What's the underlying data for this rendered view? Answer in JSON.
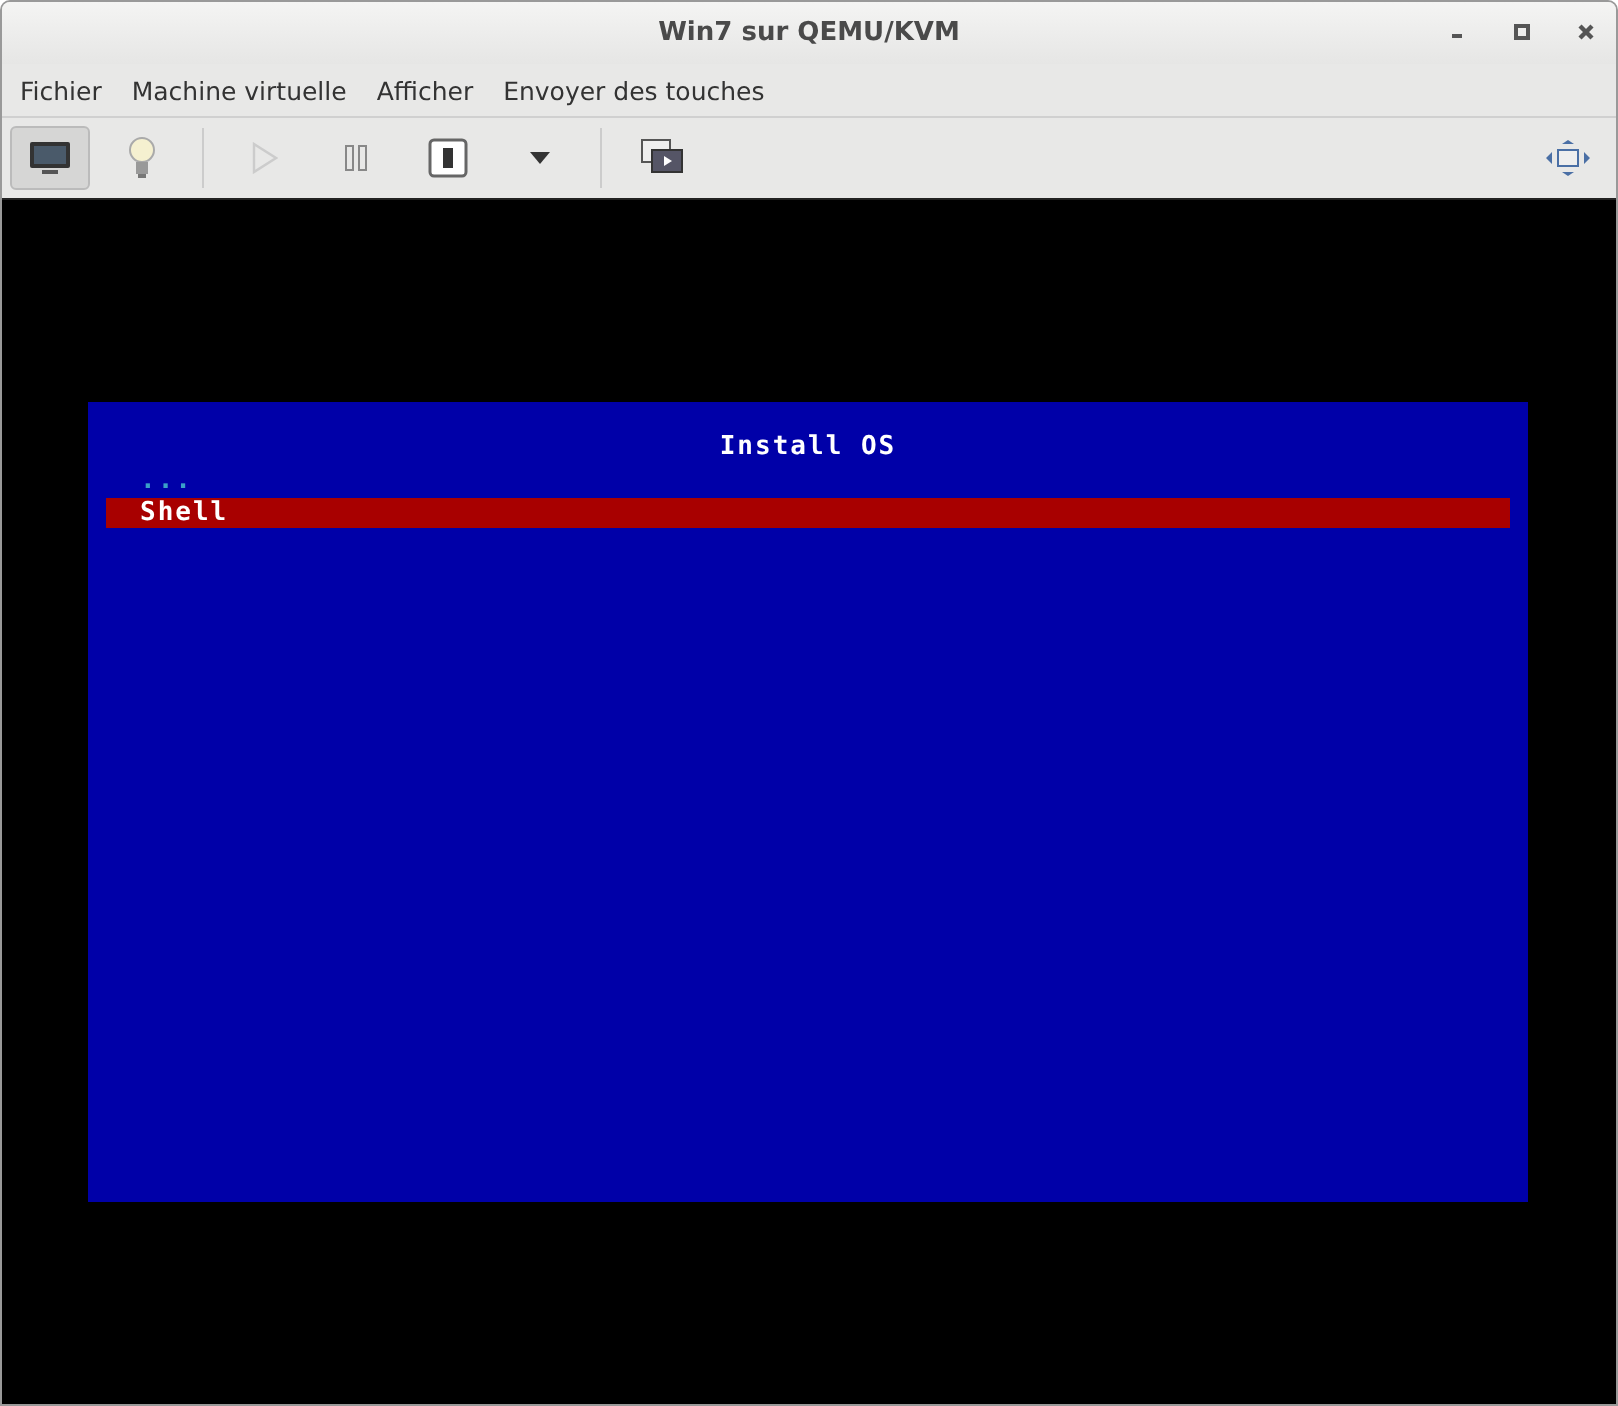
{
  "window": {
    "title": "Win7 sur QEMU/KVM"
  },
  "menu": [
    "Fichier",
    "Machine virtuelle",
    "Afficher",
    "Envoyer des touches"
  ],
  "toolbar": [
    {
      "kind": "display",
      "pressed": true,
      "disabled": false
    },
    {
      "kind": "bulb",
      "pressed": false,
      "disabled": false
    },
    {
      "kind": "separator"
    },
    {
      "kind": "play",
      "pressed": false,
      "disabled": true
    },
    {
      "kind": "pause",
      "pressed": false,
      "disabled": false
    },
    {
      "kind": "power",
      "pressed": false,
      "disabled": false
    },
    {
      "kind": "caret",
      "pressed": false,
      "disabled": false
    },
    {
      "kind": "separator"
    },
    {
      "kind": "snapshots",
      "pressed": false,
      "disabled": false
    },
    {
      "kind": "spacer"
    },
    {
      "kind": "fullscreen",
      "pressed": false,
      "disabled": false
    }
  ],
  "console": {
    "title": "Install OS",
    "items": [
      {
        "label": "...",
        "selected": false
      },
      {
        "label": "Shell",
        "selected": true
      }
    ]
  }
}
